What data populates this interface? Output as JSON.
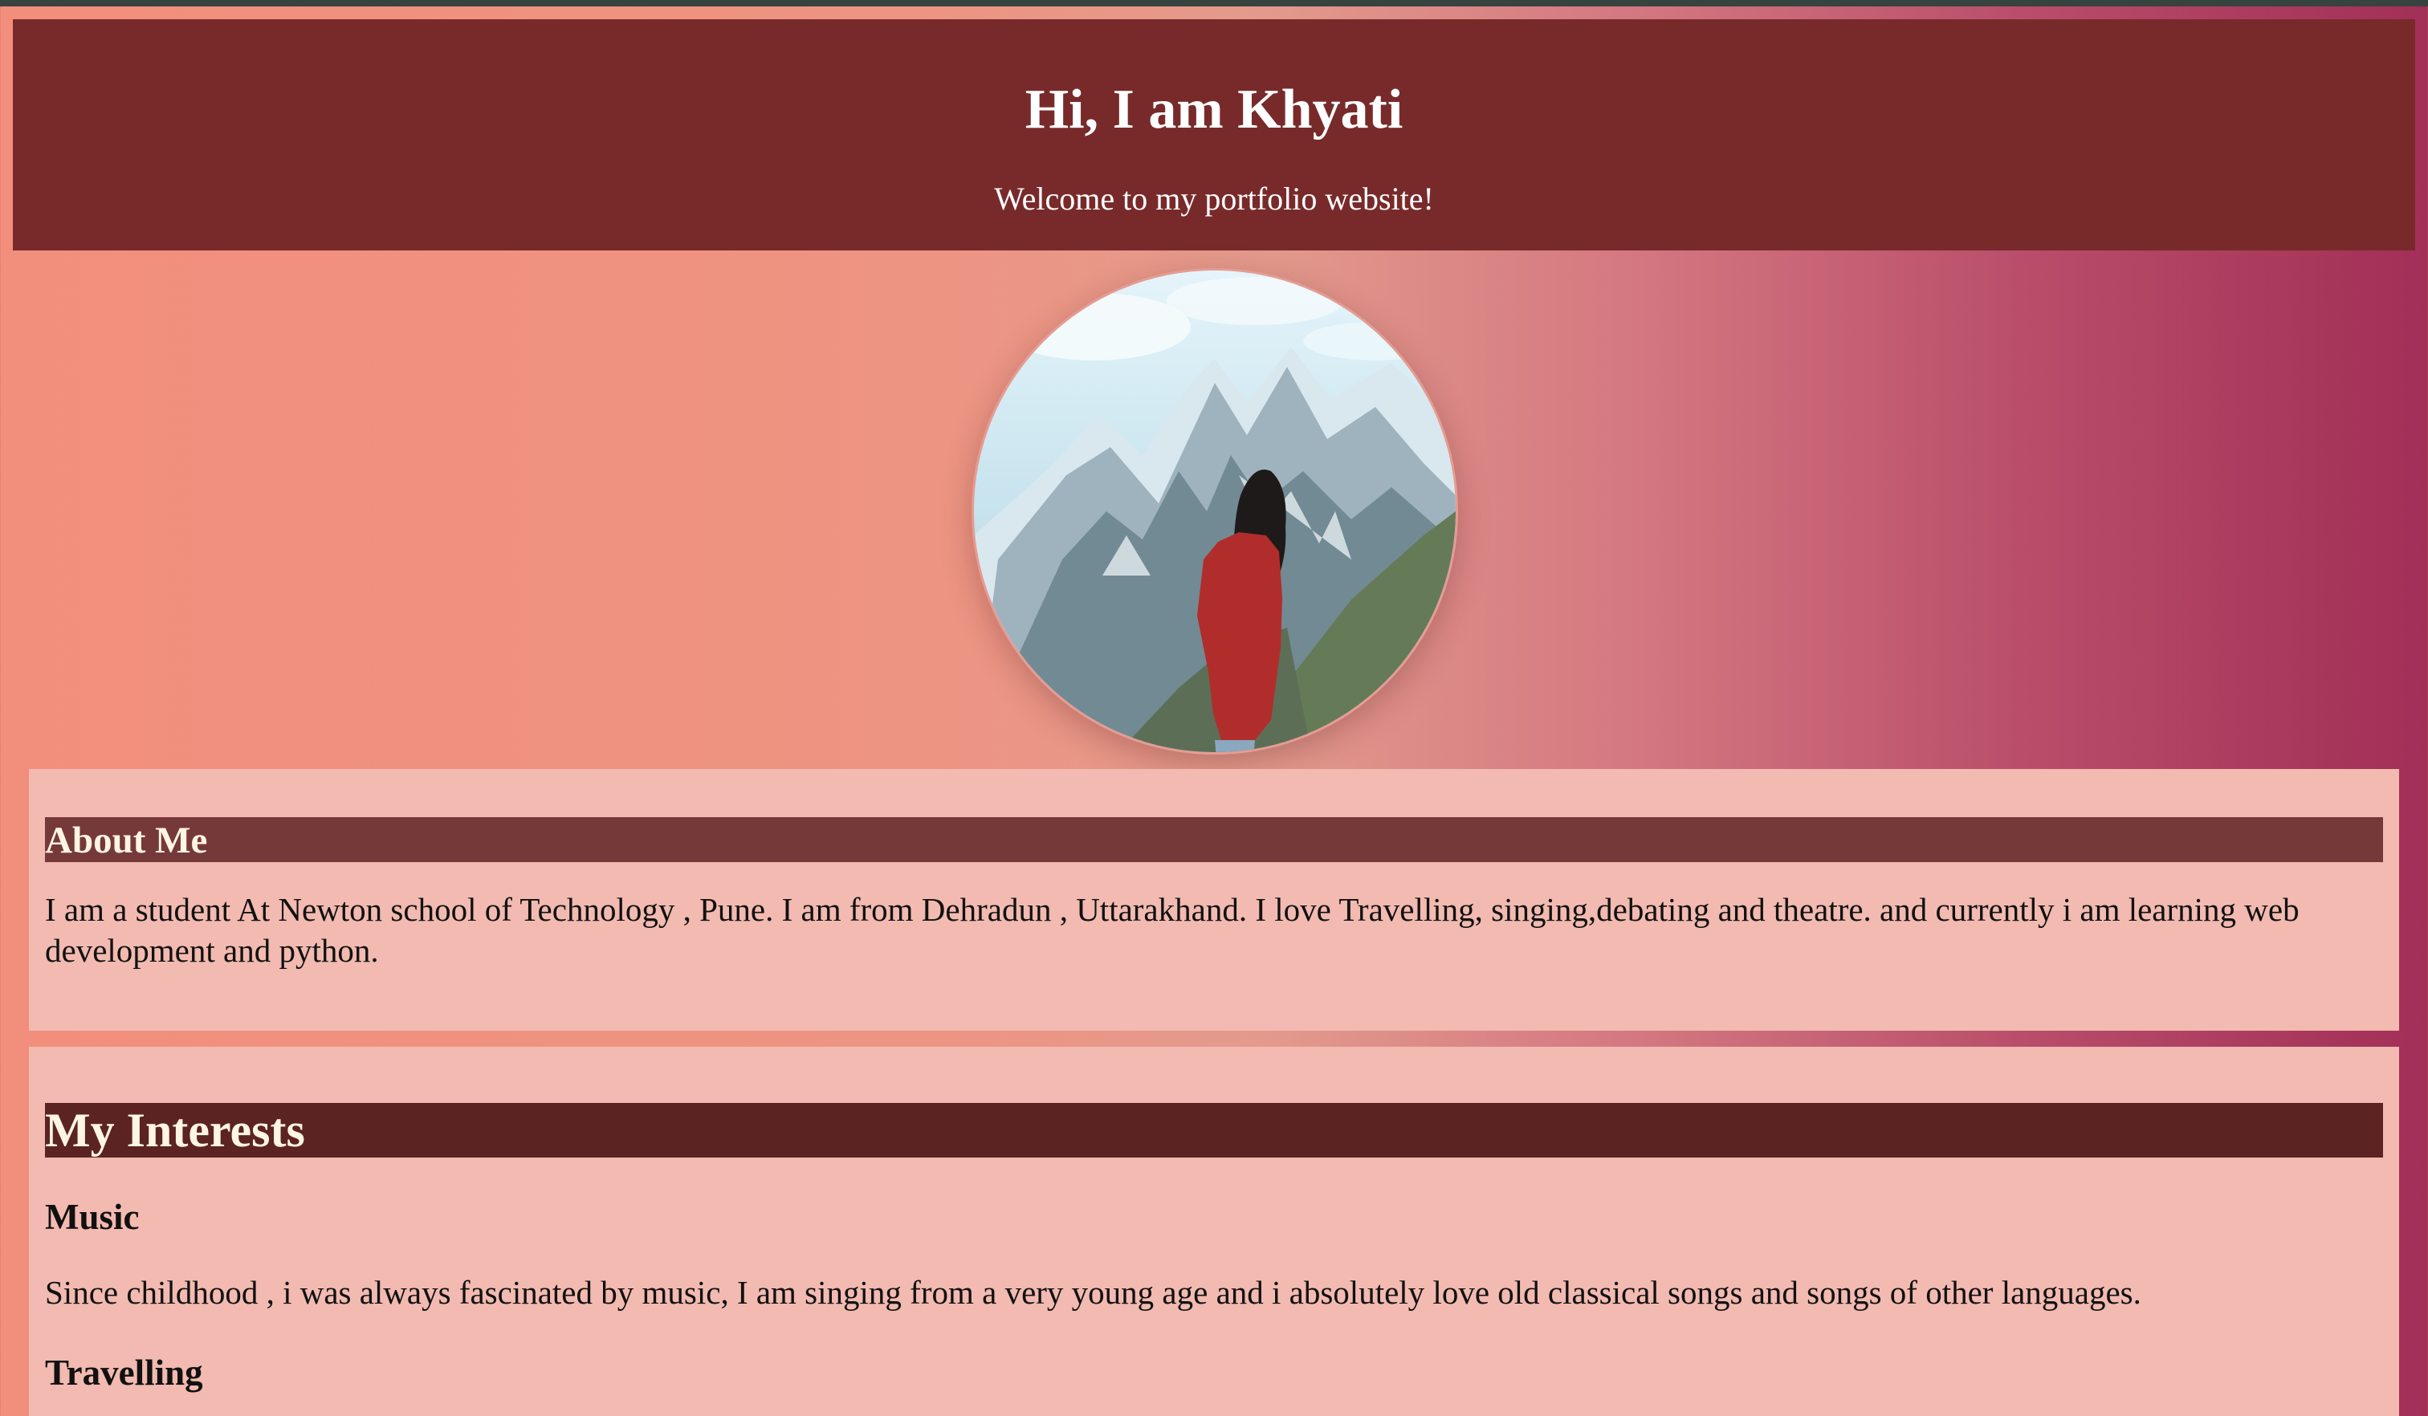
{
  "header": {
    "title": "Hi, I am Khyati",
    "subtitle": "Welcome to my portfolio website!"
  },
  "profile": {
    "alt": "Profile photo of a woman in a red jacket facing snowy mountains"
  },
  "about": {
    "heading": "About Me",
    "text": "I am a student At Newton school of Technology , Pune. I am from Dehradun , Uttarakhand. I love Travelling, singing,debating and theatre. and currently i am learning web development and python."
  },
  "interests": {
    "heading": "My Interests",
    "items": [
      {
        "title": "Music",
        "text": "Since childhood , i was always fascinated by music, I am singing from a very young age and i absolutely love old classical songs and songs of other languages."
      },
      {
        "title": "Travelling"
      }
    ]
  },
  "colors": {
    "header_bg": "#782a2b",
    "about_heading_bg": "#76393a",
    "interests_heading_bg": "#5b2322",
    "section_bg": "#f2bab0",
    "heading_text": "#fff5e3"
  }
}
